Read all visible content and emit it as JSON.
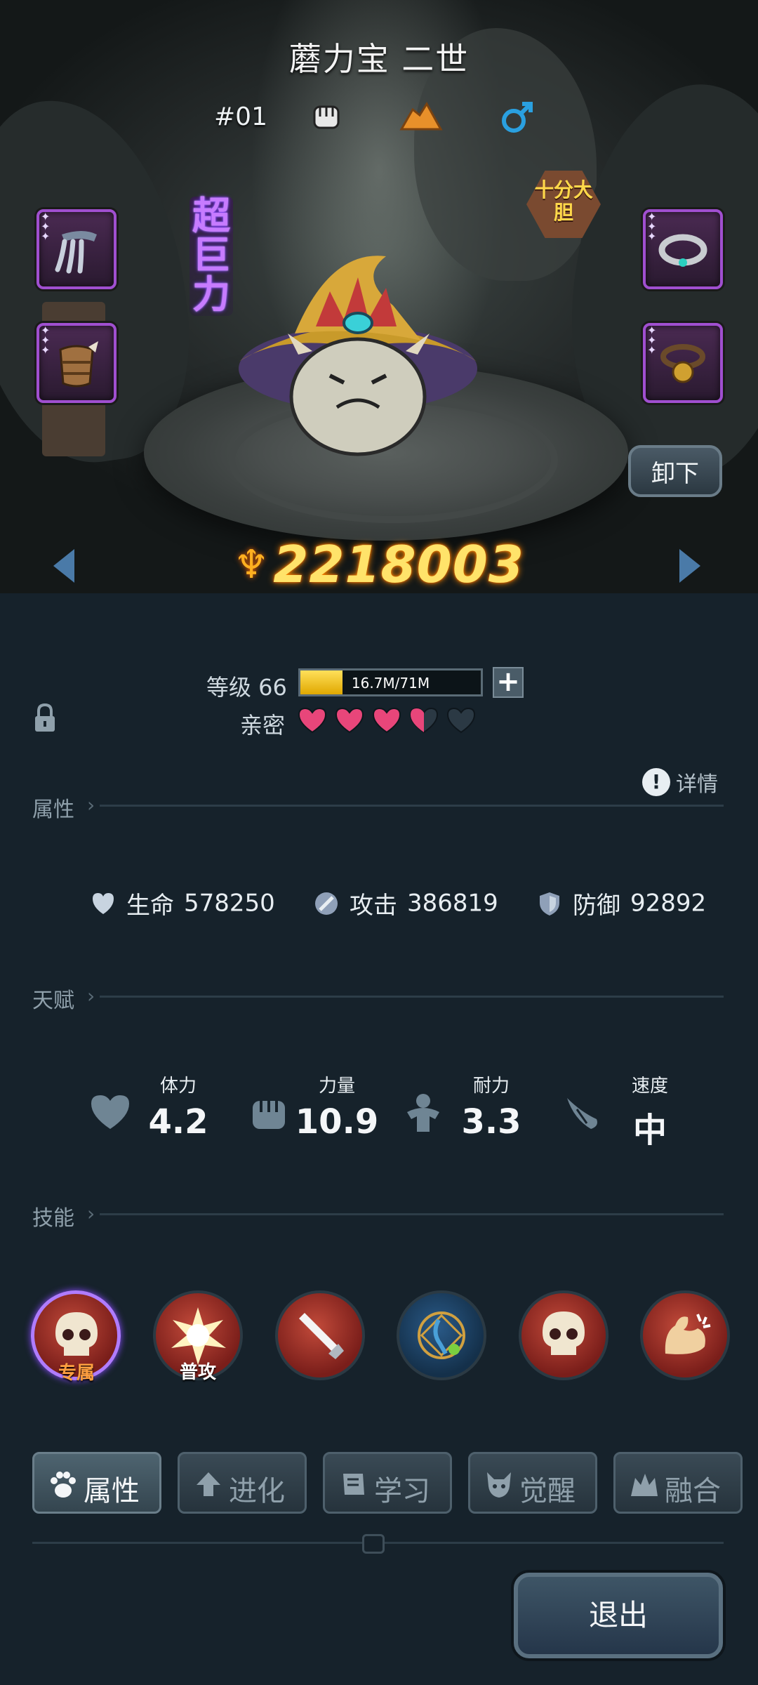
{
  "pet": {
    "name": "蘑力宝 二世",
    "number": "#01",
    "trait_vertical": "超巨力",
    "personality": "十分大胆",
    "power": "2218003"
  },
  "actions": {
    "unequip": "卸下",
    "exit": "退出"
  },
  "level": {
    "label": "等级 66",
    "xp_text": "16.7M/71M",
    "xp_progress": 0.235
  },
  "intimacy": {
    "label": "亲密",
    "hearts_full": 3,
    "hearts_half": 1,
    "hearts_total": 5
  },
  "detail_label": "详情",
  "sections": {
    "attributes": "属性",
    "talent": "天赋",
    "skills": "技能"
  },
  "attributes": [
    {
      "name": "生命",
      "value": "578250",
      "icon": "heart-shield-icon"
    },
    {
      "name": "攻击",
      "value": "386819",
      "icon": "sword-icon"
    },
    {
      "name": "防御",
      "value": "92892",
      "icon": "shield-icon"
    }
  ],
  "talents": [
    {
      "name": "体力",
      "value": "4.2",
      "icon": "heart-icon"
    },
    {
      "name": "力量",
      "value": "10.9",
      "icon": "fist-icon"
    },
    {
      "name": "耐力",
      "value": "3.3",
      "icon": "muscle-icon"
    },
    {
      "name": "速度",
      "value": "中",
      "icon": "wing-icon"
    }
  ],
  "skills": [
    {
      "tag": "专属",
      "icon": "skull-icon",
      "exclusive": true
    },
    {
      "tag": "普攻",
      "icon": "burst-icon"
    },
    {
      "tag": "",
      "icon": "sword-slash-icon"
    },
    {
      "tag": "",
      "icon": "magic-circle-icon"
    },
    {
      "tag": "",
      "icon": "skull-icon"
    },
    {
      "tag": "",
      "icon": "flex-arm-icon"
    }
  ],
  "tabs": [
    {
      "label": "属性",
      "icon": "paw-icon",
      "active": true
    },
    {
      "label": "进化",
      "icon": "up-arrow-icon"
    },
    {
      "label": "学习",
      "icon": "book-icon"
    },
    {
      "label": "觉醒",
      "icon": "demon-icon"
    },
    {
      "label": "融合",
      "icon": "fusion-icon"
    }
  ],
  "colors": {
    "accent_power": "#ffe36a",
    "exclusive_border": "#b07cff",
    "heart": "#e8467a"
  }
}
